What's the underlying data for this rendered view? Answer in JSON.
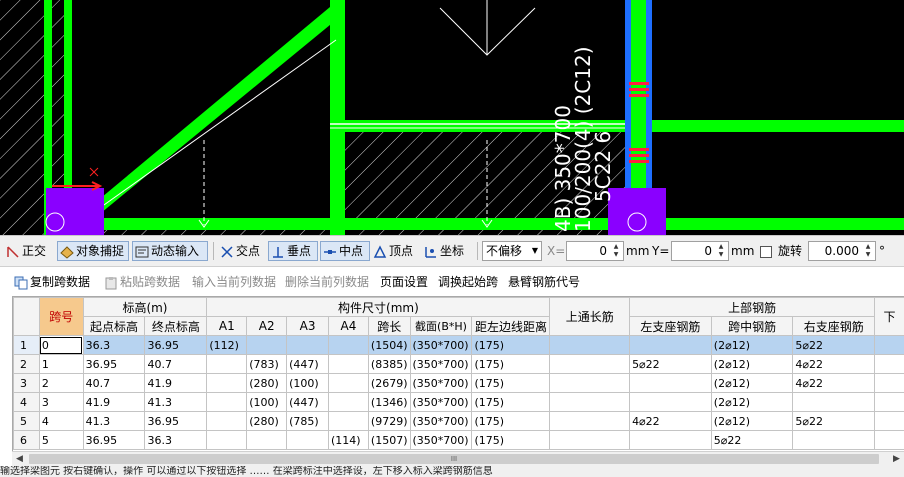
{
  "drawing": {
    "beam_labels": [
      "4B) 350*700",
      "100/200(4) (2C12)",
      "5C22 6"
    ],
    "colors": {
      "wall_green": "#00ff00",
      "column_purple": "#8a00ff",
      "rebar_blue": "#1e6fff",
      "bg_black": "#000000"
    }
  },
  "snapbar": {
    "ortho": "正交",
    "object_snap": "对象捕捉",
    "dynamic_input": "动态输入",
    "intersection": "交点",
    "perpendicular": "垂点",
    "midpoint": "中点",
    "vertex": "顶点",
    "coordinate": "坐标",
    "offset_mode": "不偏移",
    "x_label": "X=",
    "x_value": "0",
    "mm1": "mm",
    "y_label": "Y=",
    "y_value": "0",
    "mm2": "mm",
    "rotate_label": "旋转",
    "rotate_value": "0.000",
    "degree": "°"
  },
  "toolbar2": {
    "copy_span": "复制跨数据",
    "paste_span": "粘贴跨数据",
    "input_column": "输入当前列数据",
    "delete_column": "删除当前列数据",
    "page_setup": "页面设置",
    "adjust_start": "调换起始跨",
    "cantilever_code": "悬臂钢筋代号"
  },
  "grid": {
    "headers": {
      "span": "跨号",
      "elevation": "标高(m)",
      "start_elev": "起点标高",
      "end_elev": "终点标高",
      "member_size": "构件尺寸(mm)",
      "a1": "A1",
      "a2": "A2",
      "a3": "A3",
      "a4": "A4",
      "span_len": "跨长",
      "section": "截面(B*H)",
      "dist_left": "距左边线距离",
      "top_through": "上通长筋",
      "top_rebar": "上部钢筋",
      "left_support": "左支座钢筋",
      "mid_span": "跨中钢筋",
      "right_support": "右支座钢筋",
      "next": "下"
    },
    "rows": [
      {
        "n": "1",
        "span": "0",
        "start": "36.3",
        "end": "36.95",
        "a1": "(112)",
        "a2": "",
        "a3": "",
        "a4": "",
        "len": "(1504)",
        "sec": "(350*700)",
        "dist": "(175)",
        "through": "",
        "left": "",
        "mid": "(2⌀12)",
        "right": "5⌀22"
      },
      {
        "n": "2",
        "span": "1",
        "start": "36.95",
        "end": "40.7",
        "a1": "",
        "a2": "(783)",
        "a3": "(447)",
        "a4": "",
        "len": "(8385)",
        "sec": "(350*700)",
        "dist": "(175)",
        "through": "",
        "left": "5⌀22",
        "mid": "(2⌀12)",
        "right": "4⌀22"
      },
      {
        "n": "3",
        "span": "2",
        "start": "40.7",
        "end": "41.9",
        "a1": "",
        "a2": "(280)",
        "a3": "(100)",
        "a4": "",
        "len": "(2679)",
        "sec": "(350*700)",
        "dist": "(175)",
        "through": "",
        "left": "",
        "mid": "(2⌀12)",
        "right": "4⌀22"
      },
      {
        "n": "4",
        "span": "3",
        "start": "41.9",
        "end": "41.3",
        "a1": "",
        "a2": "(100)",
        "a3": "(447)",
        "a4": "",
        "len": "(1346)",
        "sec": "(350*700)",
        "dist": "(175)",
        "through": "",
        "left": "",
        "mid": "(2⌀12)",
        "right": ""
      },
      {
        "n": "5",
        "span": "4",
        "start": "41.3",
        "end": "36.95",
        "a1": "",
        "a2": "(280)",
        "a3": "(785)",
        "a4": "",
        "len": "(9729)",
        "sec": "(350*700)",
        "dist": "(175)",
        "through": "",
        "left": "4⌀22",
        "mid": "(2⌀12)",
        "right": "5⌀22"
      },
      {
        "n": "6",
        "span": "5",
        "start": "36.95",
        "end": "36.3",
        "a1": "",
        "a2": "",
        "a3": "",
        "a4": "(114)",
        "len": "(1507)",
        "sec": "(350*700)",
        "dist": "(175)",
        "through": "",
        "left": "",
        "mid": "5⌀22",
        "right": ""
      }
    ]
  },
  "scrollbar": {
    "thumb_grip": "III"
  },
  "status": "输选择梁图元 按右键确认，操作 可以通过以下按钮选择 …… 在梁跨标注中选择设，左下移入标入梁跨钢筋信息"
}
